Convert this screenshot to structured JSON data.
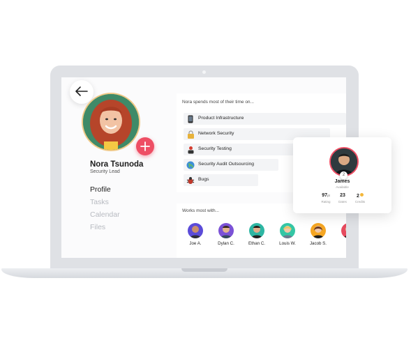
{
  "profile": {
    "name": "Nora Tsunoda",
    "role": "Security Lead",
    "nav": [
      {
        "label": "Profile",
        "active": true
      },
      {
        "label": "Tasks",
        "active": false
      },
      {
        "label": "Calendar",
        "active": false
      },
      {
        "label": "Files",
        "active": false
      }
    ]
  },
  "time_spent": {
    "title": "Nora spends most of their time on...",
    "items": [
      {
        "label": "Product Infrastructure",
        "icon": "phone-icon"
      },
      {
        "label": "Network Security",
        "icon": "lock-icon"
      },
      {
        "label": "Security Testing",
        "icon": "user-badge-icon"
      },
      {
        "label": "Security Audit Outsourcing",
        "icon": "globe-icon"
      },
      {
        "label": "Bugs",
        "icon": "bug-icon"
      }
    ]
  },
  "works_with": {
    "title": "Works most with...",
    "people": [
      {
        "name": "Joe A.",
        "ring": "#5b4bd8"
      },
      {
        "name": "Dylan C.",
        "ring": "#7b52d6"
      },
      {
        "name": "Ethan C.",
        "ring": "#2db6a3"
      },
      {
        "name": "Louis W.",
        "ring": "#34c6a5"
      },
      {
        "name": "Jacob S.",
        "ring": "#f5a623"
      },
      {
        "name": "Ju",
        "ring": "#e64a5e"
      }
    ]
  },
  "james_card": {
    "name": "James",
    "status": "Available",
    "badge": "2",
    "stats": [
      {
        "value": "97",
        "unit": "pt",
        "label": "Rating"
      },
      {
        "value": "23",
        "unit": "",
        "label": "Dates"
      },
      {
        "value": "2",
        "unit": "",
        "label": "Credits"
      }
    ]
  },
  "colors": {
    "accent": "#ee4e64",
    "avatar_ring": "#f0c987"
  }
}
